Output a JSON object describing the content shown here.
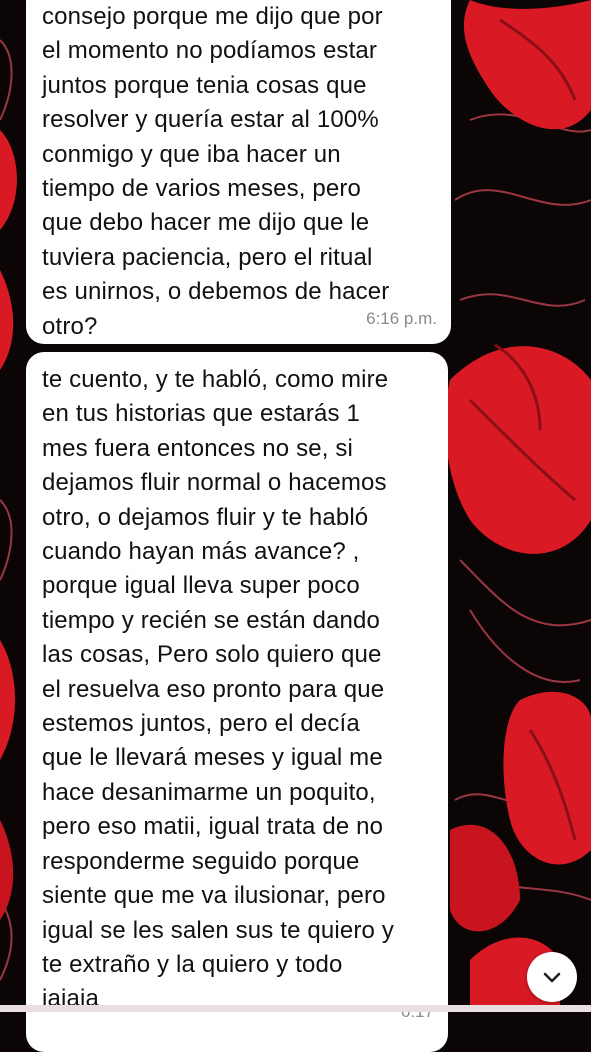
{
  "colors": {
    "background": "#0b0506",
    "flower": "#d91a25",
    "flower_dark": "#8c0f16",
    "bubble": "#ffffff",
    "text": "#111111",
    "timestamp": "#8a8a8a"
  },
  "messages": [
    {
      "text": "consejo porque me dijo que por\nel momento no podíamos estar\njuntos porque tenia cosas que\nresolver y quería estar al 100%\nconmigo y que iba hacer un\ntiempo de varios meses, pero\nque debo hacer me dijo que le\ntuviera paciencia, pero el ritual\nes unirnos,  o debemos de hacer\notro?",
      "time": "6:16 p.m."
    },
    {
      "text": "te cuento, y te habló, como mire\nen tus historias que estarás 1\nmes fuera entonces no se, si\ndejamos fluir normal o hacemos\notro, o dejamos fluir y te habló\ncuando hayan más avance? ,\nporque igual lleva super poco\ntiempo y recién se están dando\nlas cosas, Pero solo quiero que\nel resuelva eso pronto para que\nestemos juntos, pero el decía\nque le llevará meses y igual me\nhace desanimarme un poquito,\npero eso matii, igual trata de no\nresponderme seguido porque\nsiente que me va ilusionar, pero\nigual se les salen sus te quiero y\nte extraño y la quiero y todo\njajaja",
      "time": "6:17"
    }
  ],
  "scroll_button": {
    "icon": "chevron-down-icon"
  }
}
